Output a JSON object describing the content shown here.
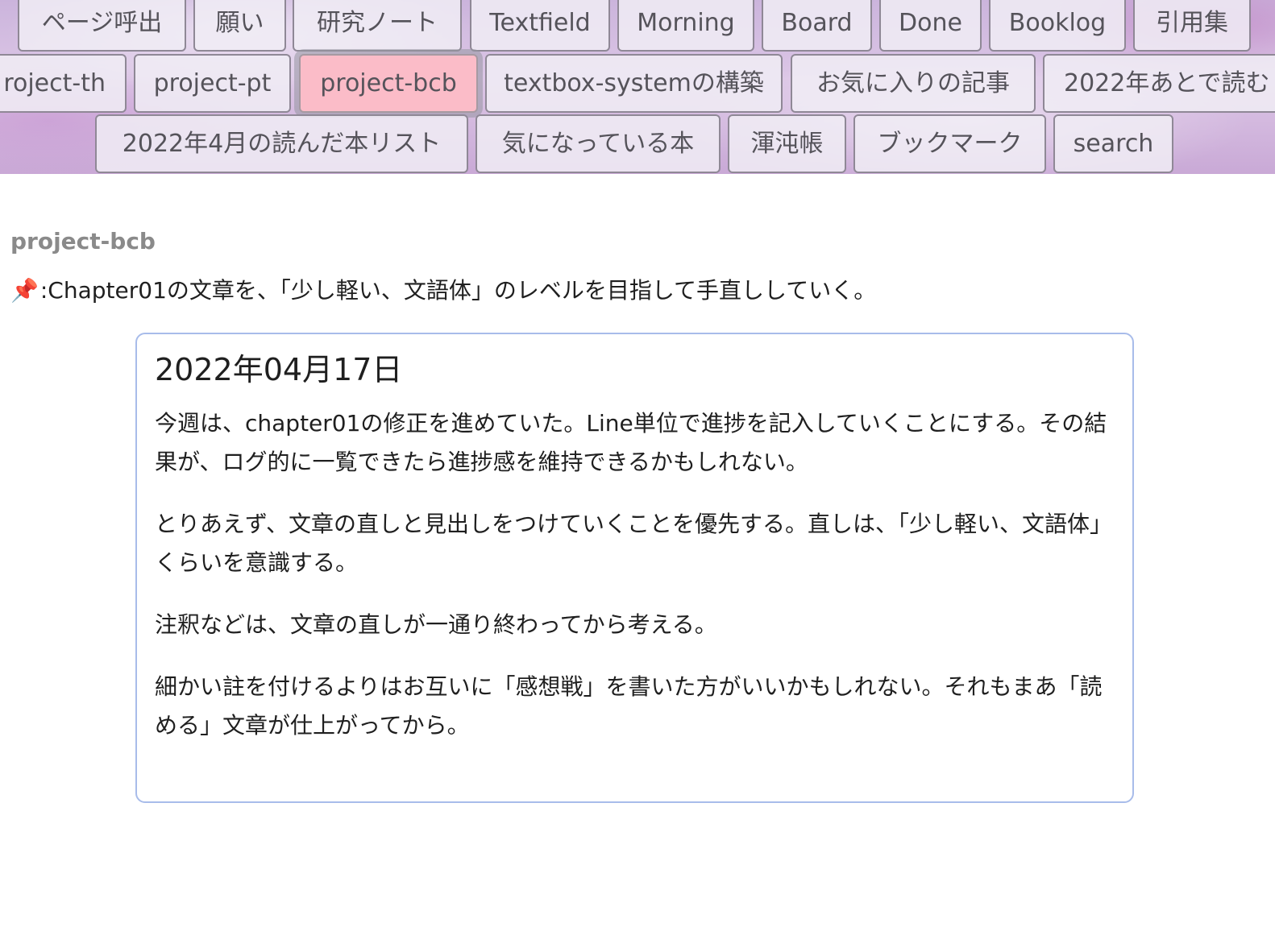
{
  "tabs": {
    "row1": [
      "ページ呼出",
      "願い",
      "研究ノート",
      "Textfield",
      "Morning",
      "Board",
      "Done",
      "Booklog",
      "引用集"
    ],
    "row2": [
      "roject-th",
      "project-pt",
      "project-bcb",
      "textbox-systemの構築",
      "お気に入りの記事",
      "2022年あとで読む"
    ],
    "row3": [
      "2022年4月の読んだ本リスト",
      "気になっている本",
      "渾沌帳",
      "ブックマーク",
      "search"
    ]
  },
  "active_tab": "project-bcb",
  "page": {
    "title": "project-bcb",
    "pin_icon": "pushpin-icon",
    "pin_glyph": "📌",
    "pin_text": ":Chapter01の文章を、「少し軽い、文語体」のレベルを目指して手直ししていく。"
  },
  "entry": {
    "date": "2022年04月17日",
    "paragraphs": [
      "今週は、chapter01の修正を進めていた。Line単位で進捗を記入していくことにする。その結果が、ログ的に一覧できたら進捗感を維持できるかもしれない。",
      "とりあえず、文章の直しと見出しをつけていくことを優先する。直しは、「少し軽い、文語体」くらいを意識する。",
      "注釈などは、文章の直しが一通り終わってから考える。",
      "細かい註を付けるよりはお互いに「感想戦」を書いた方がいいかもしれない。それもまあ「読める」文章が仕上がってから。"
    ]
  },
  "colors": {
    "active_tab": "#fbbcc8",
    "card_border": "#a8bcea",
    "title_gray": "#8a8a8a"
  }
}
